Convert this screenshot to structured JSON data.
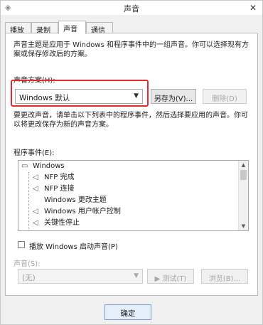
{
  "window": {
    "title": "声音"
  },
  "tabs": [
    "播放",
    "录制",
    "声音",
    "通信"
  ],
  "description": [
    "声音主题是应用于 Windows 和程序事件中的一组声音。你可以选择现有方",
    "案或保存修改后的方案。"
  ],
  "scheme": {
    "label": "声音方案(H):",
    "value": "Windows 默认",
    "save_as": "另存为(V)...",
    "delete": "删除(D)"
  },
  "instruction": [
    "要更改声音，请单击以下列表中的程序事件，然后选择要应用的声音。你可",
    "以将更改保存为新的声音方案。"
  ],
  "events": {
    "label": "程序事件(E):",
    "items": [
      {
        "text": "Windows",
        "icon": "windows-icon"
      },
      {
        "text": "NFP 完成",
        "icon": "speaker-icon"
      },
      {
        "text": "NFP 连接",
        "icon": "speaker-icon"
      },
      {
        "text": "Windows 更改主题",
        "icon": ""
      },
      {
        "text": "Windows 用户帐户控制",
        "icon": "speaker-icon"
      },
      {
        "text": "关键性停止",
        "icon": "speaker-icon"
      }
    ]
  },
  "startup": {
    "label": "播放 Windows 启动声音(P)"
  },
  "sound": {
    "label": "声音(S):",
    "value": "(无)",
    "test": "测试(T)",
    "browse": "浏览(B)..."
  },
  "footer": {
    "ok": "确定"
  }
}
